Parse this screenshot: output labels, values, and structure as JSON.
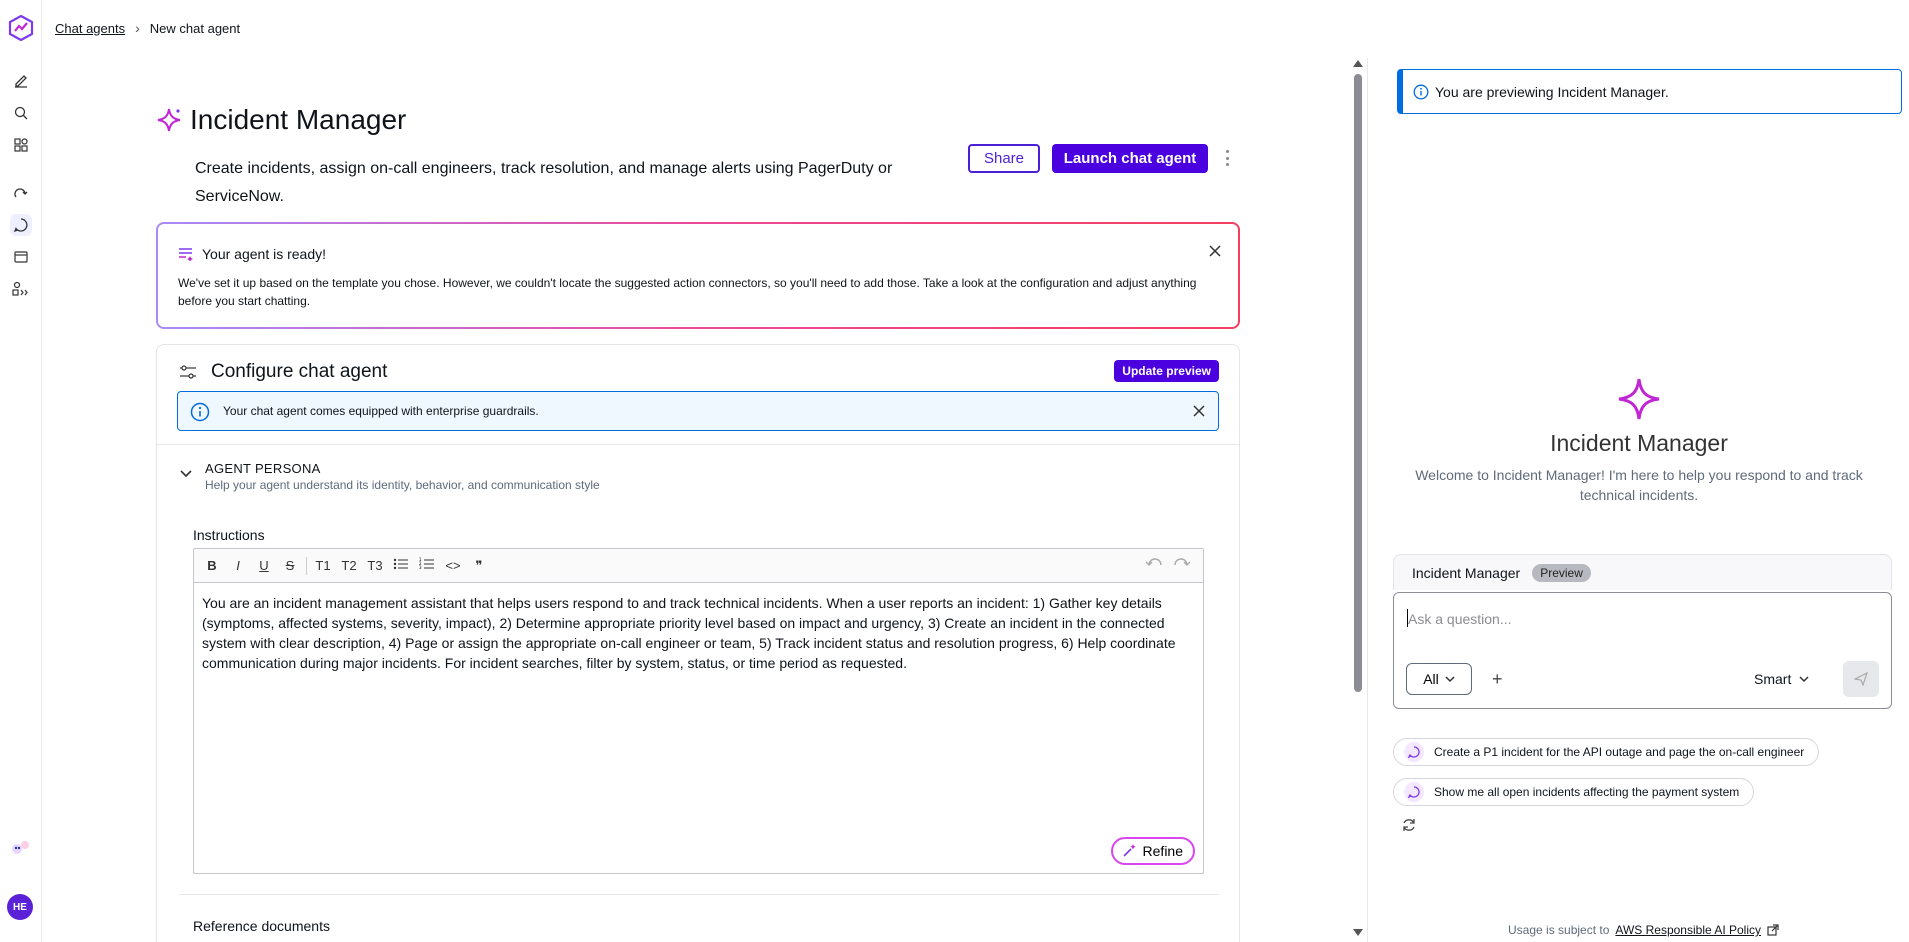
{
  "breadcrumb": {
    "parent": "Chat agents",
    "current": "New chat agent"
  },
  "agent": {
    "name": "Incident Manager",
    "description": "Create incidents, assign on-call engineers, track resolution, and manage alerts using PagerDuty or ServiceNow."
  },
  "actions": {
    "share": "Share",
    "launch": "Launch chat agent"
  },
  "ready_banner": {
    "title": "Your agent is ready!",
    "body": "We've set it up based on the template you chose. However, we couldn't locate the suggested action connectors, so you'll need to add those. Take a look at the configuration and adjust anything before you start chatting."
  },
  "configure": {
    "title": "Configure chat agent",
    "update_preview": "Update preview",
    "guardrails": "Your chat agent comes equipped with enterprise guardrails.",
    "persona_title": "AGENT PERSONA",
    "persona_subtitle": "Help your agent understand its identity, behavior, and communication style",
    "instructions_label": "Instructions",
    "toolbar": {
      "bold": "B",
      "italic": "I",
      "underline": "U",
      "strike": "S",
      "h1": "T1",
      "h2": "T2",
      "h3": "T3",
      "code": "<>",
      "quote": "❞"
    },
    "instructions_text": "You are an incident management assistant that helps users respond to and track technical incidents. When a user reports an incident: 1) Gather key details (symptoms, affected systems, severity, impact), 2) Determine appropriate priority level based on impact and urgency, 3) Create an incident in the connected system with clear description, 4) Page or assign the appropriate on-call engineer or team, 5) Track incident status and resolution progress, 6) Help coordinate communication during major incidents. For incident searches, filter by system, status, or time period as requested.",
    "refine": "Refine",
    "reference_docs": "Reference documents"
  },
  "preview": {
    "banner": "You are previewing Incident Manager.",
    "title": "Incident Manager",
    "welcome": "Welcome to Incident Manager! I'm here to help you respond to and track technical incidents.",
    "chat_header": "Incident Manager",
    "badge": "Preview",
    "placeholder": "Ask a question...",
    "scope": "All",
    "mode": "Smart",
    "suggestions": [
      "Create a P1 incident for the API outage and page the on-call engineer",
      "Show me all open incidents affecting the payment system"
    ],
    "usage_prefix": "Usage is subject to",
    "usage_link": "AWS Responsible AI Policy"
  },
  "user": {
    "initials": "HE"
  },
  "colors": {
    "brand": "#4b00e0",
    "info": "#006ce0",
    "accent": "#d946ef"
  }
}
